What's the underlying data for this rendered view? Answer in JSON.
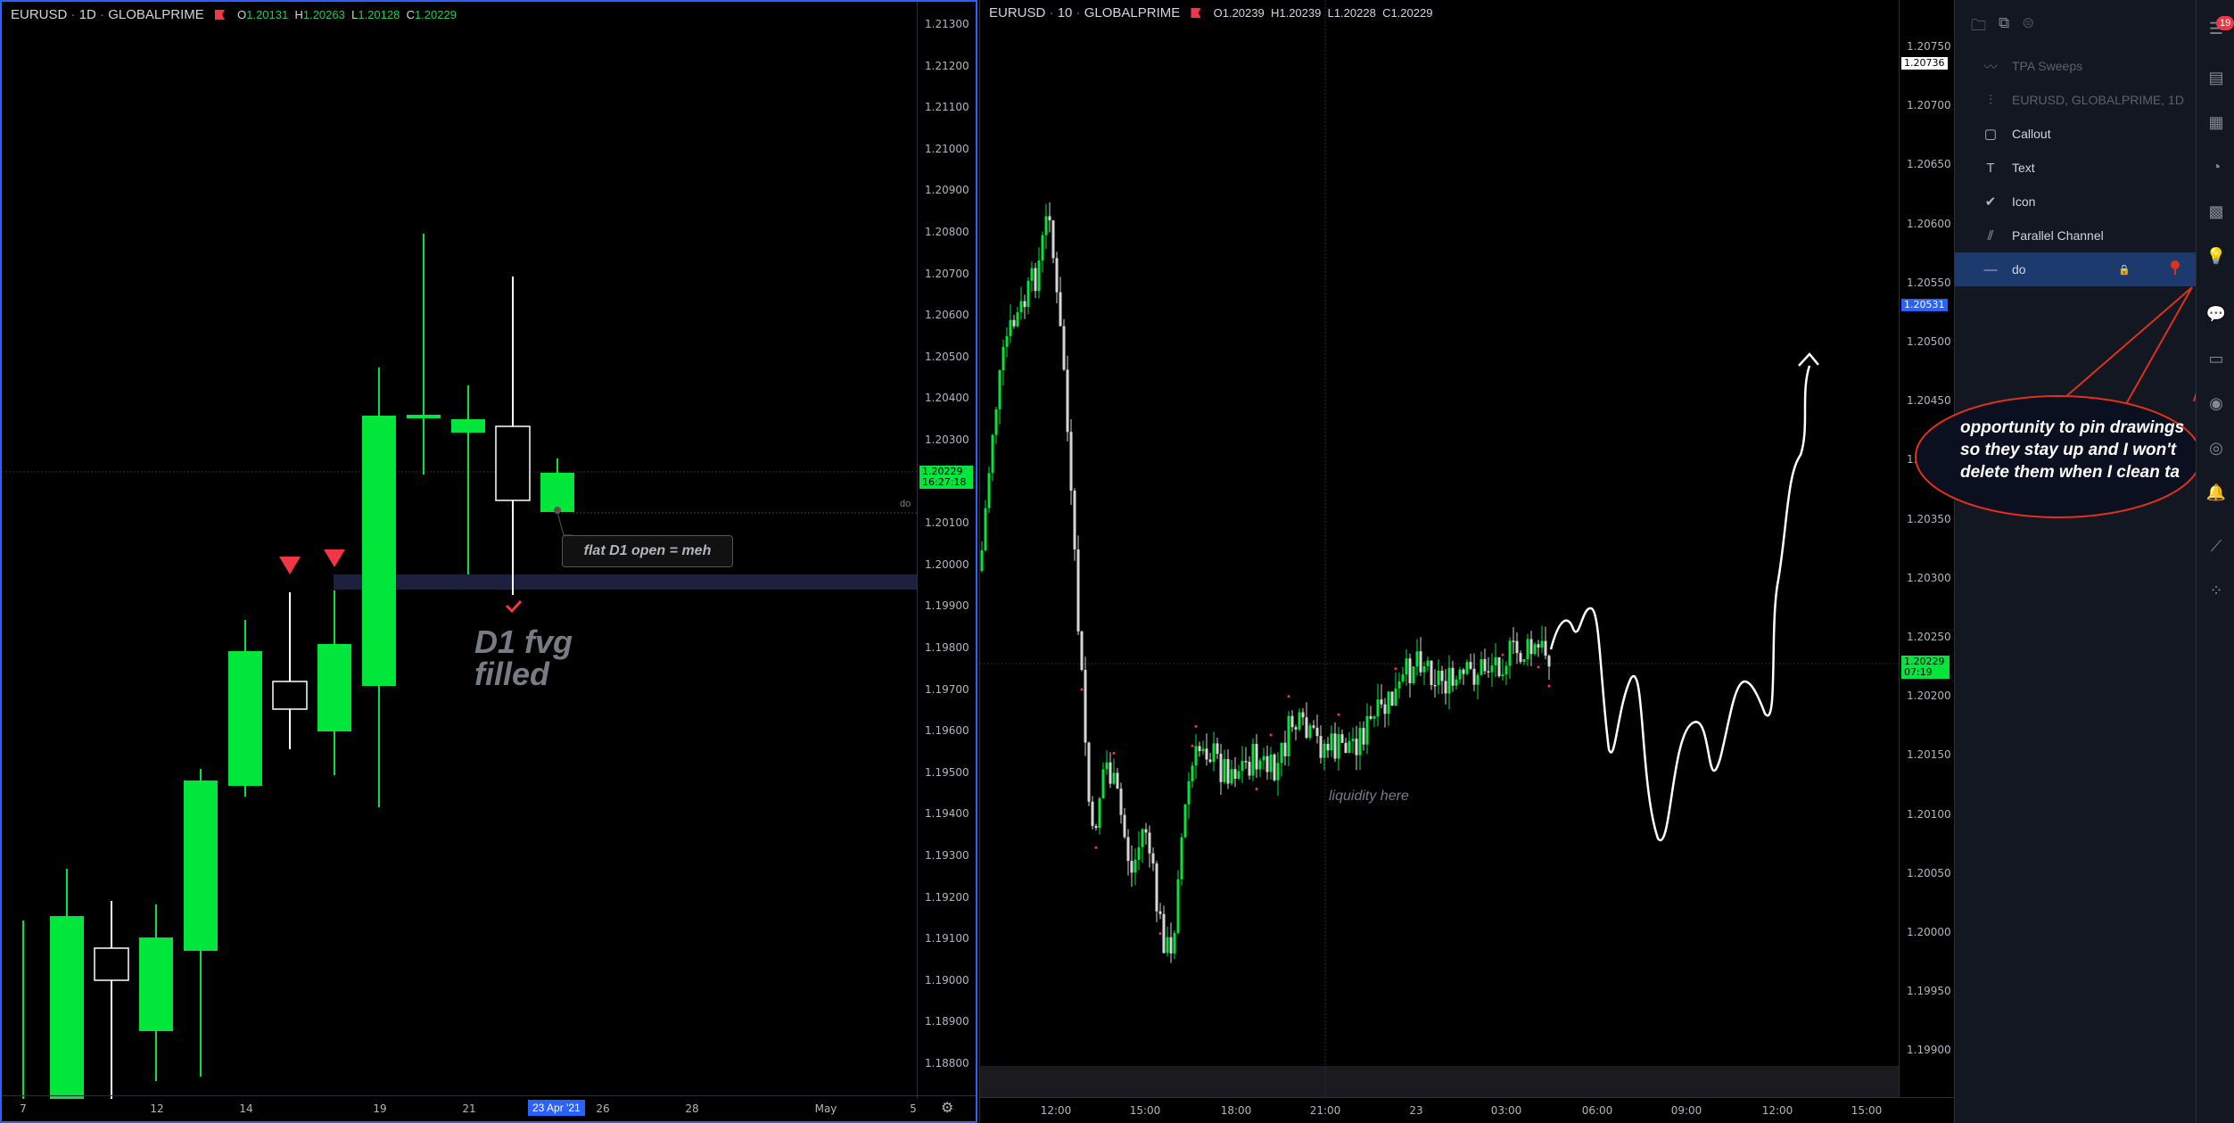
{
  "left_chart": {
    "symbol": "EURUSD",
    "interval": "1D",
    "broker": "GLOBALPRIME",
    "ohlc": {
      "o_label": "O",
      "o": "1.20131",
      "h_label": "H",
      "h": "1.20263",
      "l_label": "L",
      "l": "1.20128",
      "c_label": "C",
      "c": "1.20229"
    },
    "y_ticks": [
      "1.21300",
      "1.21200",
      "1.21100",
      "1.21000",
      "1.20900",
      "1.20800",
      "1.20700",
      "1.20600",
      "1.20500",
      "1.20400",
      "1.20300",
      "1.20200",
      "1.20100",
      "1.20000",
      "1.19900",
      "1.19800",
      "1.19700",
      "1.19600",
      "1.19500",
      "1.19400",
      "1.19300",
      "1.19200",
      "1.19100",
      "1.19000",
      "1.18900",
      "1.18800"
    ],
    "x_ticks": [
      "7",
      "12",
      "14",
      "19",
      "21",
      "26",
      "28",
      "May",
      "5"
    ],
    "x_highlight": "23 Apr '21",
    "last_price": "1.20229",
    "countdown": "16:27:18",
    "line_label": "do",
    "callout": "flat D1 open = meh",
    "note": "D1 fvg\nfilled",
    "colors": {
      "bull": "#00e63b",
      "bear": "#ffffff",
      "marker": "#f23645",
      "zone": "#1e2040"
    }
  },
  "right_chart": {
    "symbol": "EURUSD",
    "interval": "10",
    "broker": "GLOBALPRIME",
    "ohlc": {
      "o_label": "O",
      "o": "1.20239",
      "h_label": "H",
      "h": "1.20239",
      "l_label": "L",
      "l": "1.20228",
      "c_label": "C",
      "c": "1.20229"
    },
    "y_ticks": [
      "1.20750",
      "1.20700",
      "1.20650",
      "1.20600",
      "1.20550",
      "1.20500",
      "1.20450",
      "1.20400",
      "1.20350",
      "1.20300",
      "1.20250",
      "1.20200",
      "1.20150",
      "1.20100",
      "1.20050",
      "1.20000",
      "1.19950",
      "1.19900"
    ],
    "x_ticks": [
      "12:00",
      "15:00",
      "18:00",
      "21:00",
      "23",
      "03:00",
      "06:00",
      "09:00",
      "12:00",
      "15:00"
    ],
    "high_tag": "1.20736",
    "blue_tag": "1.20531",
    "last_price": "1.20229",
    "countdown": "07:19",
    "annotation": "liquidity here"
  },
  "objects_tree": {
    "items": [
      {
        "label": "TPA Sweeps",
        "icon": "wave-icon",
        "dim": true
      },
      {
        "label": "EURUSD, GLOBALPRIME, 1D",
        "icon": "candles-icon",
        "dim": true
      },
      {
        "label": "Callout",
        "icon": "callout-icon",
        "dim": false
      },
      {
        "label": "Text",
        "icon": "text-icon",
        "dim": false
      },
      {
        "label": "Icon",
        "icon": "check-icon",
        "dim": false
      },
      {
        "label": "Parallel Channel",
        "icon": "channel-icon",
        "dim": false
      },
      {
        "label": "do",
        "icon": "horizontal-ray-icon",
        "dim": false,
        "selected": true
      }
    ]
  },
  "annotation_bubble": "opportunity to pin drawings so they stay up and I won't delete them when I clean ta",
  "rail": {
    "badge": "19"
  }
}
